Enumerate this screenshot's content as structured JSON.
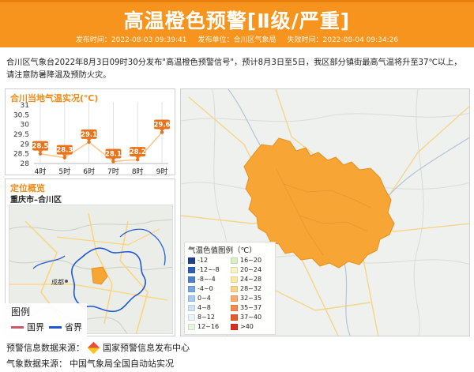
{
  "banner": {
    "title": "高温橙色预警[Ⅱ级/严重]",
    "color": "#f7941d",
    "issue_time": "发布时间：2022-08-03 09:39:41",
    "issuer": "发布单位：合川区气象局",
    "expire_time": "失效时间：2022-08-04 09:34:26"
  },
  "description": "合川区气象台2022年8月3日09时30分发布\"高温橙色预警信号\"，预计8月3日至5日，我区部分镇街最高气温将升至37℃以上，请注意防暑降温及预防火灾。",
  "temp_panel": {
    "title": "合川当地气温实况(℃)"
  },
  "chart_data": {
    "type": "line",
    "title": "合川当地气温实况(℃)",
    "categories": [
      "4时",
      "5时",
      "6时",
      "7时",
      "8时",
      "9时"
    ],
    "values": [
      28.5,
      28.3,
      29.1,
      28.1,
      28.2,
      29.6
    ],
    "value_labels": [
      "28.5",
      "28.3",
      "29.1",
      "28.1",
      "28.2",
      "29.6"
    ],
    "yticks": [
      "31",
      "30.5",
      "30",
      "29.5",
      "29",
      "28.5",
      "28"
    ],
    "ylim": [
      28,
      31
    ],
    "grid": true,
    "line_color": "#f7941d",
    "label_color": "#e8731a"
  },
  "location_panel": {
    "title": "定位概览",
    "subtitle": "重庆市–合川区",
    "legend_title": "图例",
    "legend_items": [
      {
        "label": "国界",
        "color": "#c9586a"
      },
      {
        "label": "省界",
        "color": "#1f56d6"
      }
    ],
    "places": [
      "成都"
    ]
  },
  "main_map": {
    "region_color": "#f7a535",
    "scale_title": "气温色值图例（℃）",
    "scale_left": [
      {
        "label": "-12",
        "color": "#1f3f8f"
      },
      {
        "label": "-12~-8",
        "color": "#2e5fb8"
      },
      {
        "label": "-8~-4",
        "color": "#4c80cf"
      },
      {
        "label": "-4~0",
        "color": "#78a6e0"
      },
      {
        "label": "0~4",
        "color": "#a6c9ef"
      },
      {
        "label": "4~8",
        "color": "#cfe3f7"
      },
      {
        "label": "8~12",
        "color": "#e8f3fb"
      },
      {
        "label": "12~16",
        "color": "#e6f6dc"
      }
    ],
    "scale_right": [
      {
        "label": "16~20",
        "color": "#d6f0c4"
      },
      {
        "label": "20~24",
        "color": "#f3f6c2"
      },
      {
        "label": "24~28",
        "color": "#fbe9a6"
      },
      {
        "label": "28~32",
        "color": "#f9d38a"
      },
      {
        "label": "32~35",
        "color": "#f6ac6a"
      },
      {
        "label": "35~37",
        "color": "#f08a4f"
      },
      {
        "label": "37~40",
        "color": "#e35a2b"
      },
      {
        "label": ">40",
        "color": "#d62e1f"
      }
    ]
  },
  "footer": {
    "source_label": "预警信息数据来源：",
    "source_value": "国家预警信息发布中心",
    "weather_label": "气象数据来源：",
    "weather_value": "中国气象局全国自动站实况"
  }
}
